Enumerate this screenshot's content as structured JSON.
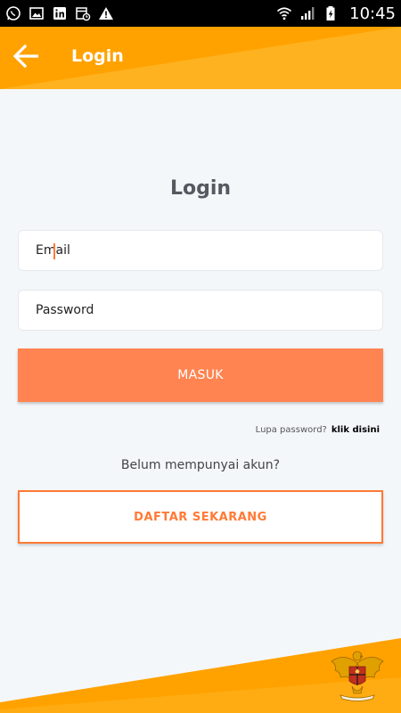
{
  "status_bar": {
    "time": "10:45",
    "left_icons": [
      "whatsapp-icon",
      "gallery-icon",
      "linkedin-icon",
      "calendar-alarm-icon",
      "warning-icon"
    ],
    "right_icons": [
      "wifi-icon",
      "signal-icon",
      "battery-charging-icon"
    ]
  },
  "app_bar": {
    "title": "Login",
    "back_icon": "arrow-left-icon"
  },
  "form": {
    "heading": "Login",
    "email_placeholder": "Email",
    "password_placeholder": "Password",
    "submit_label": "MASUK",
    "forgot_text": "Lupa password?",
    "forgot_link": "klik disini",
    "no_account_text": "Belum mempunyai akun?",
    "register_label": "DAFTAR SEKARANG"
  },
  "footer": {
    "emblem": "garuda-emblem"
  },
  "colors": {
    "primary_orange": "#ffa200",
    "button_orange": "#ff8451",
    "accent_orange": "#ff7a35",
    "background": "#f4f7fa"
  }
}
